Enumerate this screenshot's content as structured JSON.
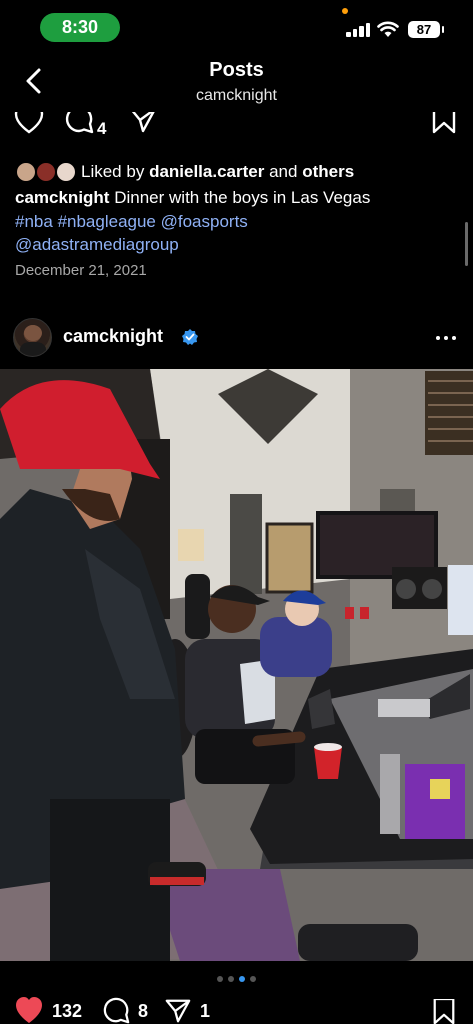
{
  "status_bar": {
    "time": "8:30",
    "battery": "87"
  },
  "nav": {
    "title": "Posts",
    "subtitle": "camcknight"
  },
  "previous_post": {
    "comment_count": "4",
    "liked_by_prefix": "Liked by",
    "liked_by_user": "daniella.carter",
    "liked_by_and": "and",
    "liked_by_others": "others",
    "caption_user": "camcknight",
    "caption_text": "Dinner with the boys in Las Vegas",
    "tags": [
      "#nba",
      "#nbagleague",
      "@foasports",
      "@adastramediagroup"
    ],
    "date": "December 21, 2021"
  },
  "post": {
    "username": "camcknight",
    "verified": true,
    "carousel": {
      "count": 4,
      "active_index": 2
    },
    "likes": "132",
    "comments": "8",
    "shares": "1"
  },
  "colors": {
    "like_red": "#ed4956",
    "verified_blue": "#3897f0",
    "tag_blue": "#8fb1f5",
    "status_green": "#1e9e3f"
  }
}
